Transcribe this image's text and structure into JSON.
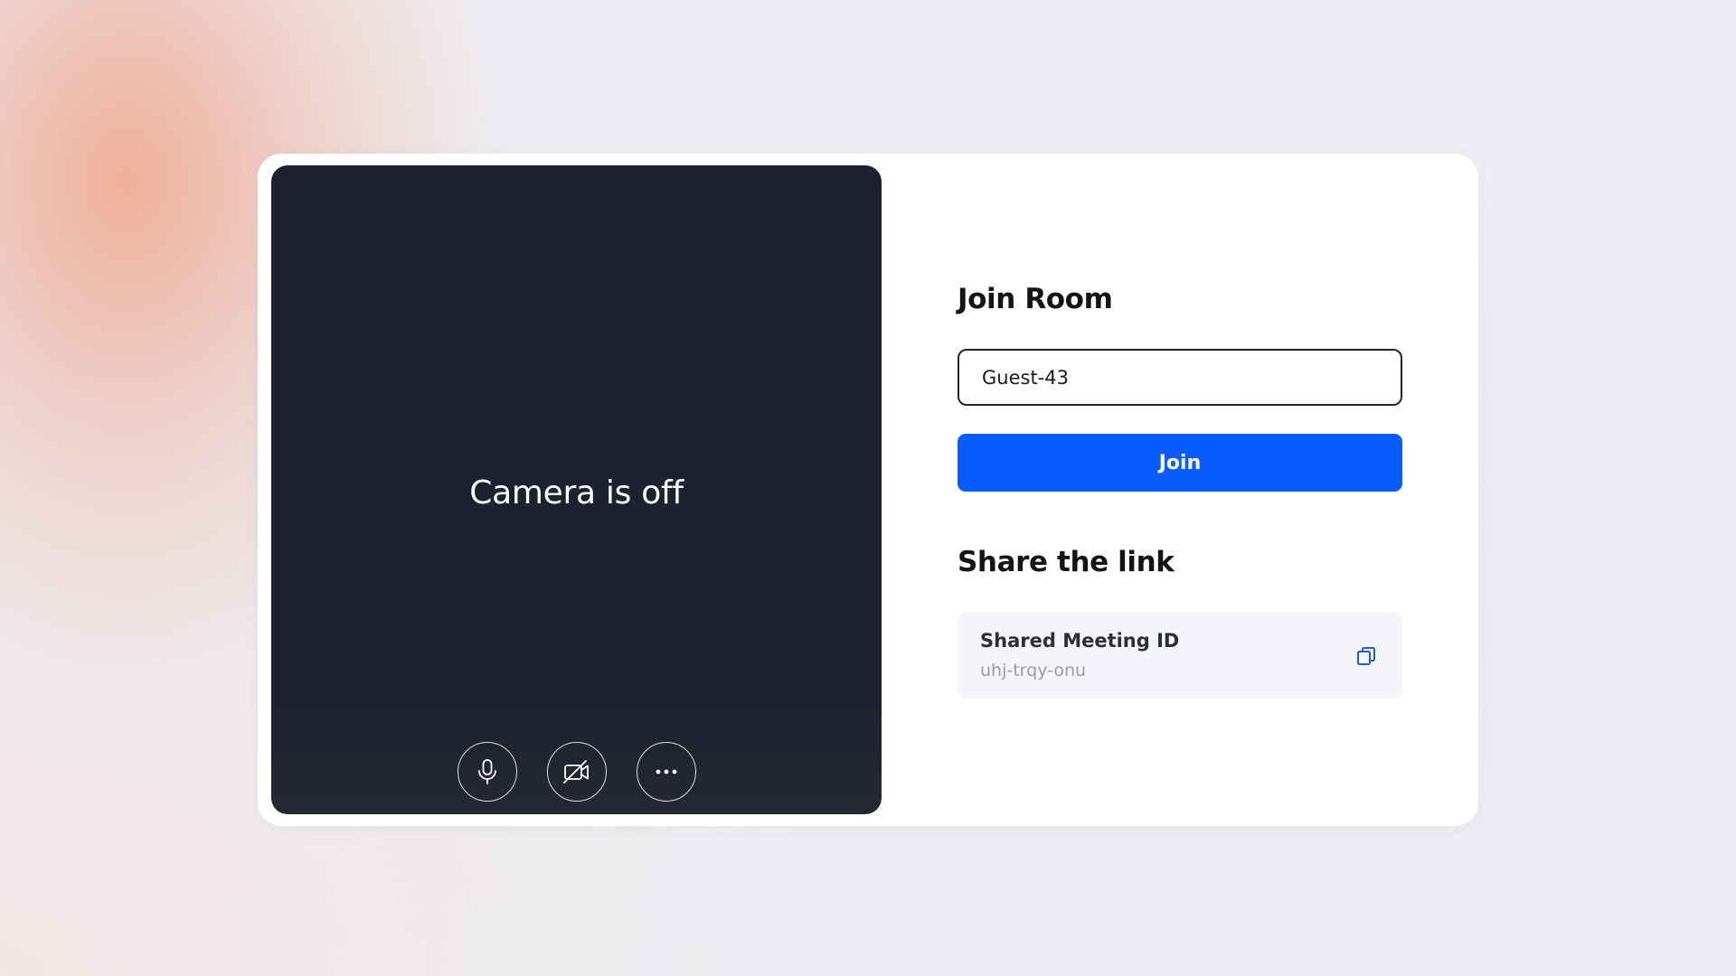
{
  "preview": {
    "camera_status": "Camera is off",
    "controls": [
      {
        "icon": "microphone-icon"
      },
      {
        "icon": "camera-off-icon"
      },
      {
        "icon": "more-icon"
      }
    ]
  },
  "join": {
    "title": "Join Room",
    "name_value": "Guest-43",
    "button_label": "Join"
  },
  "share": {
    "title": "Share the link",
    "label": "Shared Meeting ID",
    "meeting_id": "uhj-trqy-onu",
    "copy_icon": "copy-icon"
  },
  "colors": {
    "primary": "#0a5cff",
    "preview_bg": "#1e2230",
    "share_box_bg": "#f4f5f8",
    "copy_icon": "#1f5fd6"
  }
}
